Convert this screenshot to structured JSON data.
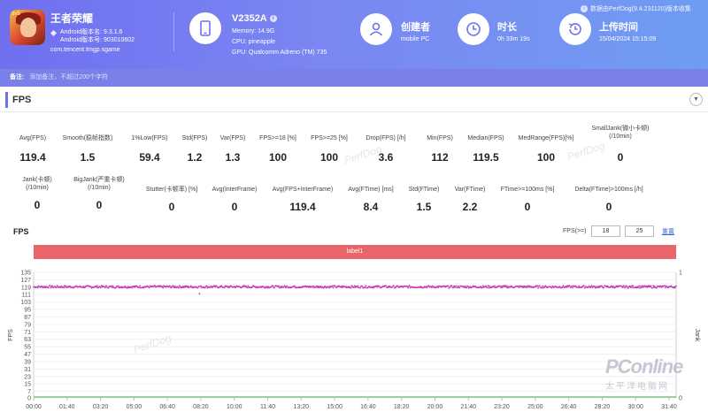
{
  "header": {
    "app": {
      "name": "王者荣耀",
      "android_version_name": "Android版本名: 9.3.1.6",
      "android_version_code": "Android版本号: 903010602",
      "package": "com.tencent.tmgp.sgame",
      "icon_badge": "5v5"
    },
    "device": {
      "name": "V2352A",
      "memory": "Memory: 14.9G",
      "cpu": "CPU: pineapple",
      "gpu": "GPU: Qualcomm Adreno (TM) 735"
    },
    "creator": {
      "label": "创建者",
      "value": "mobile PC"
    },
    "duration": {
      "label": "时长",
      "value": "0h 33m 19s"
    },
    "upload": {
      "label": "上传时间",
      "value": "15/04/2024 15:15:09"
    },
    "version_note": "数据由PerfDog(9.4.231120)版本收集"
  },
  "note_bar": {
    "label": "备注:",
    "placeholder": "添加备注，不超过200个字符"
  },
  "section": {
    "title": "FPS",
    "collapse_icon": "chevron-down-icon"
  },
  "metrics_row1": [
    {
      "label": "Avg(FPS)",
      "value": "119.4"
    },
    {
      "label": "Smooth(稳帧指数)",
      "value": "1.5"
    },
    {
      "label": "1%Low(FPS)",
      "value": "59.4"
    },
    {
      "label": "Std(FPS)",
      "value": "1.2"
    },
    {
      "label": "Var(FPS)",
      "value": "1.3"
    },
    {
      "label": "FPS>=18 [%]",
      "value": "100"
    },
    {
      "label": "FPS>=25 [%]",
      "value": "100"
    },
    {
      "label": "Drop(FPS) [/h]",
      "value": "3.6"
    },
    {
      "label": "Min(FPS)",
      "value": "112"
    },
    {
      "label": "Median(FPS)",
      "value": "119.5"
    },
    {
      "label": "MedRange(FPS)[%]",
      "value": "100"
    },
    {
      "label": "SmallJank(微小卡顿)",
      "label2": "(/10min)",
      "value": "0"
    }
  ],
  "metrics_row2": [
    {
      "label": "Jank(卡顿)",
      "label2": "(/10min)",
      "value": "0"
    },
    {
      "label": "BigJank(严重卡顿)",
      "label2": "(/10min)",
      "value": "0"
    },
    {
      "label": "Stutter(卡顿率) [%]",
      "value": "0"
    },
    {
      "label": "Avg(InterFrame)",
      "value": "0"
    },
    {
      "label": "Avg(FPS+InterFrame)",
      "value": "119.4"
    },
    {
      "label": "Avg(FTime) [ms]",
      "value": "8.4"
    },
    {
      "label": "Std(FTime)",
      "value": "1.5"
    },
    {
      "label": "Var(FTime)",
      "value": "2.2"
    },
    {
      "label": "FTime>=100ms [%]",
      "value": "0"
    },
    {
      "label": "Delta(FTime)>100ms [/h]",
      "value": "0"
    }
  ],
  "chart_controls": {
    "title": "FPS",
    "fps_threshold_label": "FPS(>=)",
    "fps_threshold_1": "18",
    "fps_threshold_2": "25",
    "reset_label": "重置",
    "label_bar": "label1"
  },
  "watermarks": {
    "perfdog": "PerfDog",
    "pconline_logo": "PConline",
    "pconline_sub": "太平洋电脑网"
  },
  "chart_data": {
    "type": "scatter",
    "title": "",
    "ylabel": "FPS",
    "y2label": "Jank",
    "ylim": [
      0,
      135
    ],
    "y2lim": [
      0,
      1
    ],
    "y_ticks": [
      0,
      7,
      15,
      23,
      31,
      39,
      47,
      55,
      63,
      71,
      79,
      87,
      95,
      103,
      111,
      119,
      127,
      135
    ],
    "y2_ticks": [
      0,
      1
    ],
    "x_ticks": [
      "00:00",
      "01:40",
      "03:20",
      "05:00",
      "06:40",
      "08:20",
      "10:00",
      "11:40",
      "13:20",
      "15:00",
      "16:40",
      "18:20",
      "20:00",
      "21:40",
      "23:20",
      "25:00",
      "26:40",
      "28:20",
      "30:00",
      "31:40"
    ],
    "x_range_seconds": [
      0,
      1999
    ],
    "series": [
      {
        "name": "FPS",
        "color": "#c23cb8",
        "approx_value": 119.4,
        "min": 112,
        "max": 121
      },
      {
        "name": "Jank",
        "color": "#6bb86a",
        "approx_value": 0
      }
    ]
  }
}
